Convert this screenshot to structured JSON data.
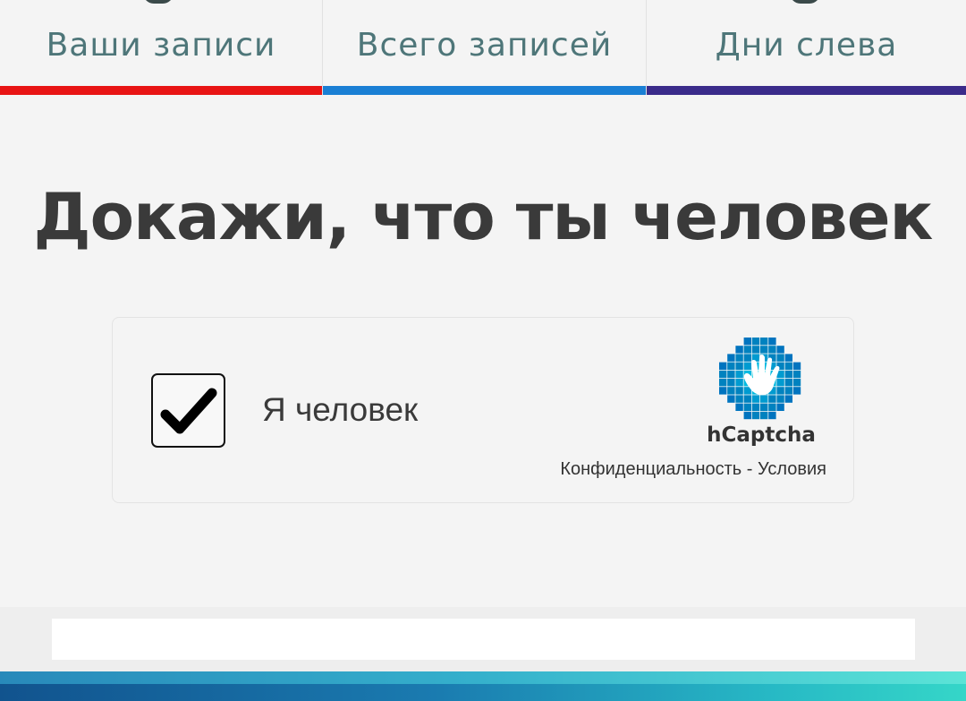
{
  "tabs": [
    {
      "label": "Ваши записи",
      "underline_color": "#e81414"
    },
    {
      "label": "Всего записей",
      "underline_color": "#1a7fd4"
    },
    {
      "label": "Дни слева",
      "underline_color": "#3a2b8a"
    }
  ],
  "heading": "Докажи, что ты человек",
  "captcha": {
    "checked": true,
    "label": "Я человек",
    "brand": "hCaptcha",
    "privacy_link": "Конфиденциальность",
    "separator": " - ",
    "terms_link": "Условия",
    "logo_colors": [
      "#0074bf",
      "#0082bf",
      "#009bd0",
      "#00b9e0",
      "#00ccdf"
    ]
  },
  "colors": {
    "background": "#f4f4f4",
    "heading": "#3a3a3a",
    "tab_text": "#4e7679"
  }
}
